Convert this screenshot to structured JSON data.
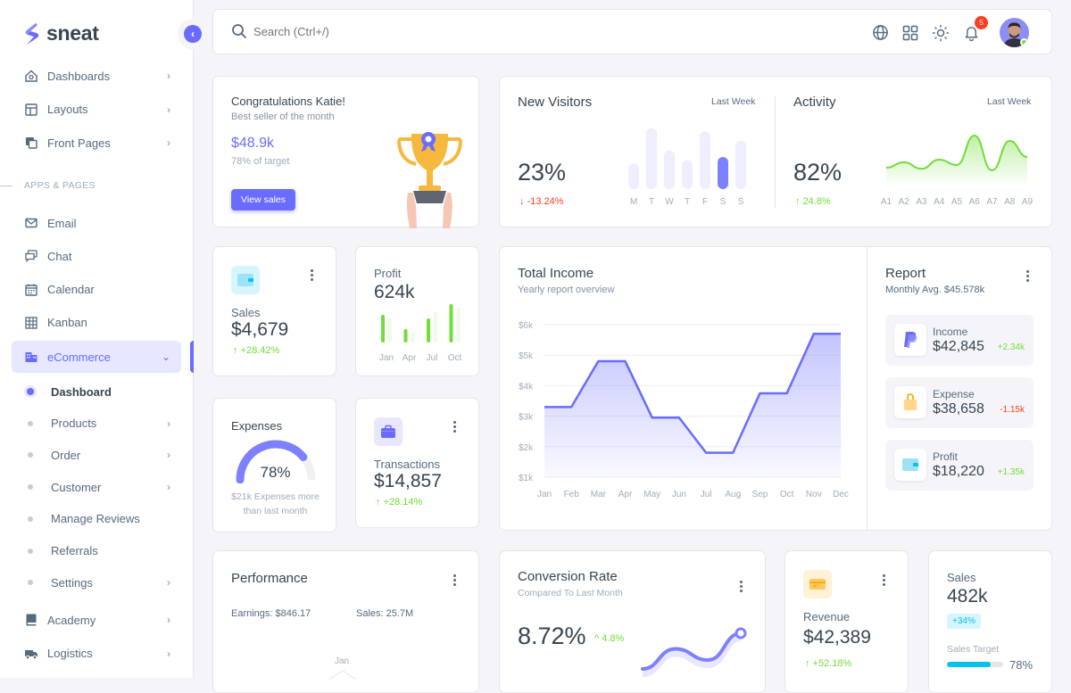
{
  "brand": {
    "name": "sneat",
    "accent": "#696cff"
  },
  "sidebar": {
    "collapse_icon": "chevron-left-icon",
    "top_items": [
      {
        "label": "Dashboards",
        "icon": "home-icon",
        "has_children": true
      },
      {
        "label": "Layouts",
        "icon": "layout-icon",
        "has_children": true
      },
      {
        "label": "Front Pages",
        "icon": "pages-icon",
        "has_children": true
      }
    ],
    "section_label": "APPS & PAGES",
    "app_items": [
      {
        "label": "Email",
        "icon": "mail-icon"
      },
      {
        "label": "Chat",
        "icon": "chat-icon"
      },
      {
        "label": "Calendar",
        "icon": "calendar-icon"
      },
      {
        "label": "Kanban",
        "icon": "grid-icon"
      }
    ],
    "active_group": {
      "label": "eCommerce",
      "icon": "building-icon",
      "expanded": true
    },
    "sub_items": [
      {
        "label": "Dashboard",
        "active": true,
        "has_children": false
      },
      {
        "label": "Products",
        "active": false,
        "has_children": true
      },
      {
        "label": "Order",
        "active": false,
        "has_children": true
      },
      {
        "label": "Customer",
        "active": false,
        "has_children": true
      },
      {
        "label": "Manage Reviews",
        "active": false,
        "has_children": false
      },
      {
        "label": "Referrals",
        "active": false,
        "has_children": false
      },
      {
        "label": "Settings",
        "active": false,
        "has_children": true
      }
    ],
    "bottom_items": [
      {
        "label": "Academy",
        "icon": "book-icon",
        "has_children": true
      },
      {
        "label": "Logistics",
        "icon": "truck-icon",
        "has_children": true
      }
    ]
  },
  "navbar": {
    "search_placeholder": "Search (Ctrl+/)",
    "notification_count": "5",
    "icons": [
      "globe-icon",
      "apps-grid-icon",
      "sun-icon",
      "bell-icon"
    ]
  },
  "congrats": {
    "title": "Congratulations Katie!",
    "subtitle": "Best seller of the month",
    "amount": "$48.9k",
    "target": "78% of target",
    "button": "View sales"
  },
  "new_visitors": {
    "title": "New Visitors",
    "period": "Last Week",
    "value": "23%",
    "change": "-13.24%",
    "highlight_index": 5
  },
  "activity": {
    "title": "Activity",
    "period": "Last Week",
    "value": "82%",
    "change": "24.8%"
  },
  "sales_card": {
    "label": "Sales",
    "value": "$4,679",
    "change": "+28.42%"
  },
  "profit_card": {
    "label": "Profit",
    "value": "624k"
  },
  "expenses_card": {
    "label": "Expenses",
    "percent": "78%",
    "gauge_fraction": 0.78,
    "note_line1": "$21k Expenses more",
    "note_line2": "than last month"
  },
  "transactions_card": {
    "label": "Transactions",
    "value": "$14,857",
    "change": "+28.14%"
  },
  "total_income": {
    "title": "Total Income",
    "subtitle": "Yearly report overview"
  },
  "report": {
    "title": "Report",
    "subtitle": "Monthly Avg. $45.578k",
    "items": [
      {
        "label": "Income",
        "value": "$42,845",
        "change": "+2.34k",
        "positive": true,
        "icon": "paypal-icon"
      },
      {
        "label": "Expense",
        "value": "$38,658",
        "change": "-1.15k",
        "positive": false,
        "icon": "shopping-bag-icon"
      },
      {
        "label": "Profit",
        "value": "$18,220",
        "change": "+1.35k",
        "positive": true,
        "icon": "wallet-icon"
      }
    ]
  },
  "performance": {
    "title": "Performance",
    "earnings": "Earnings: $846.17",
    "sales": "Sales: 25.7M",
    "radar_label": "Jan"
  },
  "conversion": {
    "title": "Conversion Rate",
    "subtitle": "Compared To Last Month",
    "value": "8.72%",
    "change": "4.8%"
  },
  "revenue_card": {
    "label": "Revenue",
    "value": "$42,389",
    "change": "+52.18%"
  },
  "sales_target_card": {
    "label": "Sales",
    "value": "482k",
    "badge": "+34%",
    "target_label": "Sales Target",
    "target_percent": "78%",
    "target_fraction": 0.78
  },
  "chart_data": [
    {
      "type": "bar",
      "title": "New Visitors",
      "categories": [
        "M",
        "T",
        "W",
        "T",
        "F",
        "S",
        "S"
      ],
      "values": [
        40,
        95,
        60,
        45,
        90,
        50,
        75
      ],
      "ylim": [
        0,
        100
      ]
    },
    {
      "type": "area",
      "title": "Activity",
      "categories": [
        "A1",
        "A2",
        "A3",
        "A4",
        "A5",
        "A6",
        "A7",
        "A8",
        "A9"
      ],
      "values": [
        35,
        45,
        33,
        50,
        40,
        95,
        30,
        85,
        55
      ],
      "ylim": [
        0,
        100
      ]
    },
    {
      "type": "bar",
      "title": "Profit",
      "categories": [
        "Jan",
        "Apr",
        "Jul",
        "Oct"
      ],
      "series": [
        {
          "name": "current",
          "values": [
            31,
            15,
            27,
            43
          ]
        },
        {
          "name": "previous",
          "values": [
            27,
            11,
            35,
            39
          ]
        }
      ],
      "ylim": [
        0,
        45
      ]
    },
    {
      "type": "area",
      "title": "Total Income",
      "subtitle": "Yearly report overview",
      "categories": [
        "Jan",
        "Feb",
        "Mar",
        "Apr",
        "May",
        "Jun",
        "Jul",
        "Aug",
        "Sep",
        "Oct",
        "Nov",
        "Dec"
      ],
      "values": [
        3.3,
        3.3,
        4.8,
        4.8,
        2.95,
        2.95,
        1.8,
        1.8,
        3.75,
        3.75,
        5.7,
        5.7
      ],
      "yticks": [
        "$1k",
        "$2k",
        "$3k",
        "$4k",
        "$5k",
        "$6k"
      ],
      "ylim": [
        1,
        6
      ],
      "grid": true
    },
    {
      "type": "line",
      "title": "Conversion Rate",
      "values": [
        10,
        55,
        30,
        90
      ]
    }
  ]
}
